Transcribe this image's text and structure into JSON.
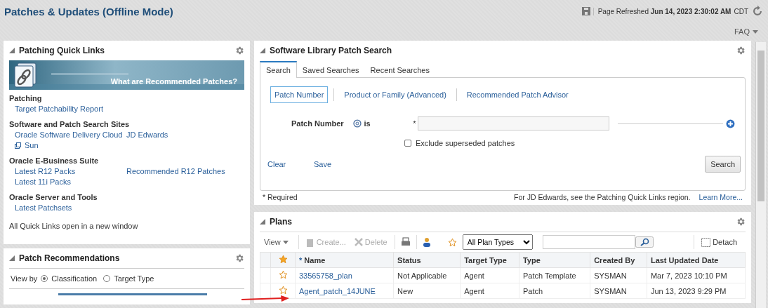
{
  "header": {
    "title": "Patches & Updates (Offline Mode)",
    "refreshed_label": "Page Refreshed",
    "refreshed_time": "Jun 14, 2023 2:30:02 AM",
    "timezone": "CDT",
    "faq": "FAQ"
  },
  "quick_links": {
    "title": "Patching Quick Links",
    "banner_text": "What are Recommended Patches?",
    "groups": [
      {
        "heading": "Patching",
        "links": [
          {
            "label": "Target Patchability Report",
            "external": false
          }
        ]
      },
      {
        "heading": "Software and Patch Search Sites",
        "links": [
          {
            "label": "Oracle Software Delivery Cloud",
            "external": false
          },
          {
            "label": "JD Edwards",
            "external": false
          },
          {
            "label": "Sun",
            "external": true
          }
        ]
      },
      {
        "heading": "Oracle E-Business Suite",
        "links": [
          {
            "label": "Latest R12 Packs",
            "external": false
          },
          {
            "label": "Recommended R12 Patches",
            "external": false
          },
          {
            "label": "Latest 11i Packs",
            "external": false
          }
        ]
      },
      {
        "heading": "Oracle Server and Tools",
        "links": [
          {
            "label": "Latest Patchsets",
            "external": false
          }
        ]
      }
    ],
    "note": "All Quick Links open in a new window"
  },
  "recommendations": {
    "title": "Patch Recommendations",
    "view_by_label": "View by",
    "options": [
      {
        "label": "Classification",
        "selected": true
      },
      {
        "label": "Target Type",
        "selected": false
      }
    ]
  },
  "patch_search": {
    "title": "Software Library Patch Search",
    "tabs": [
      {
        "label": "Search",
        "selected": true
      },
      {
        "label": "Saved Searches",
        "selected": false
      },
      {
        "label": "Recent Searches",
        "selected": false
      }
    ],
    "modes": [
      {
        "label": "Patch Number",
        "selected": true
      },
      {
        "label": "Product or Family (Advanced)",
        "selected": false
      },
      {
        "label": "Recommended Patch Advisor",
        "selected": false
      }
    ],
    "field_label": "Patch Number",
    "operator": "is",
    "required_mark": "*",
    "exclude_superseded": {
      "label": "Exclude superseded patches",
      "checked": false
    },
    "clear": "Clear",
    "save": "Save",
    "search_button": "Search",
    "required_note": "* Required",
    "jd_note": "For JD Edwards, see the Patching Quick Links region.",
    "learn_more": "Learn More..."
  },
  "plans": {
    "title": "Plans",
    "view": "View",
    "create": "Create...",
    "delete": "Delete",
    "plan_type": "All Plan Types",
    "detach": "Detach",
    "columns": [
      {
        "label": "Name",
        "required": true
      },
      {
        "label": "Status",
        "required": false
      },
      {
        "label": "Target Type",
        "required": false
      },
      {
        "label": "Type",
        "required": false
      },
      {
        "label": "Created By",
        "required": false
      },
      {
        "label": "Last Updated Date",
        "required": false
      }
    ],
    "rows": [
      {
        "favorite": false,
        "cells": [
          "33565758_plan",
          "Not Applicable",
          "Agent",
          "Patch Template",
          "SYSMAN",
          "Mar 7, 2023 10:10 PM"
        ]
      },
      {
        "favorite": false,
        "cells": [
          "Agent_patch_14JUNE",
          "New",
          "Agent",
          "Patch",
          "SYSMAN",
          "Jun 13, 2023 9:29 PM"
        ]
      }
    ]
  }
}
